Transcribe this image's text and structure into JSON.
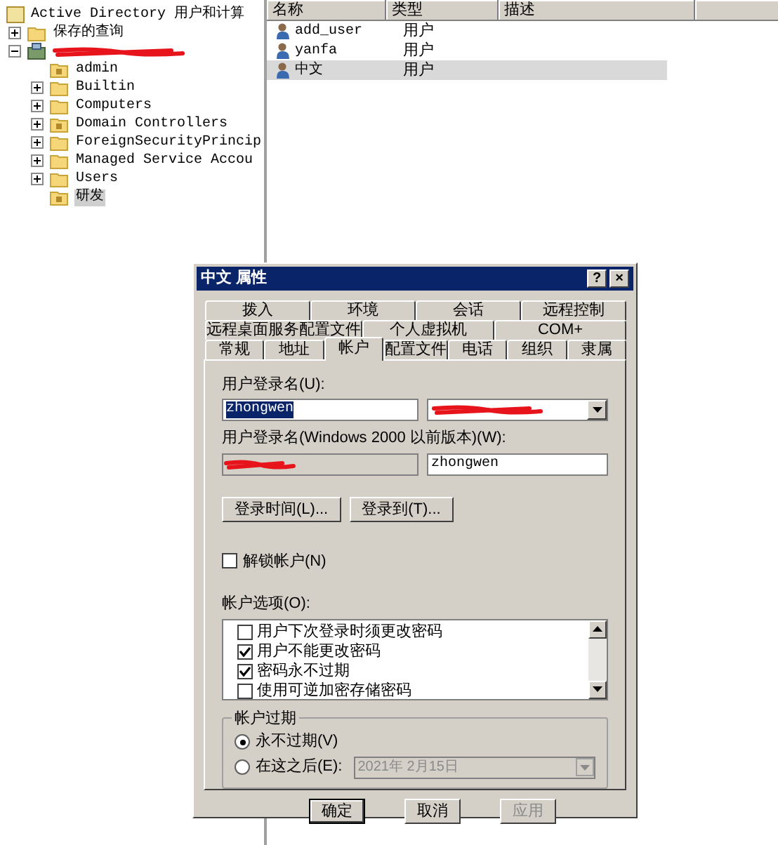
{
  "tree": {
    "header": "Active Directory 用户和计算",
    "items": [
      {
        "kind": "folder",
        "label": "保存的查询",
        "expandable": true,
        "expanded": false,
        "selected": false
      },
      {
        "kind": "domain",
        "redacted": true,
        "expandable": true,
        "expanded": true,
        "selected": false,
        "children": [
          {
            "kind": "ou",
            "label": "admin",
            "expandable": false,
            "selected": false
          },
          {
            "kind": "folder",
            "label": "Builtin",
            "expandable": true,
            "expanded": false,
            "selected": false
          },
          {
            "kind": "folder",
            "label": "Computers",
            "expandable": true,
            "expanded": false,
            "selected": false
          },
          {
            "kind": "ou",
            "label": "Domain Controllers",
            "expandable": true,
            "expanded": false,
            "selected": false
          },
          {
            "kind": "folder",
            "label": "ForeignSecurityPrincip",
            "expandable": true,
            "expanded": false,
            "selected": false
          },
          {
            "kind": "folder",
            "label": "Managed Service Accou",
            "expandable": true,
            "expanded": false,
            "selected": false
          },
          {
            "kind": "folder",
            "label": "Users",
            "expandable": true,
            "expanded": false,
            "selected": false
          },
          {
            "kind": "ou",
            "label": "研发",
            "expandable": false,
            "selected": true
          }
        ]
      }
    ]
  },
  "list": {
    "columns": [
      "名称",
      "类型",
      "描述"
    ],
    "rows": [
      {
        "name": "add_user",
        "type": "用户",
        "selected": false
      },
      {
        "name": "yanfa",
        "type": "用户",
        "selected": false
      },
      {
        "name": "中文",
        "type": "用户",
        "selected": true
      }
    ]
  },
  "dialog": {
    "title": "中文 属性",
    "title_buttons": [
      "?",
      "×"
    ],
    "tab_rows": [
      [
        {
          "label": "拨入",
          "selected": false
        },
        {
          "label": "环境",
          "selected": false
        },
        {
          "label": "会话",
          "selected": false
        },
        {
          "label": "远程控制",
          "selected": false
        }
      ],
      [
        {
          "label": "远程桌面服务配置文件",
          "selected": false
        },
        {
          "label": "个人虚拟机",
          "selected": false
        },
        {
          "label": "COM+",
          "selected": false
        }
      ],
      [
        {
          "label": "常规",
          "selected": false
        },
        {
          "label": "地址",
          "selected": false
        },
        {
          "label": "帐户",
          "selected": true
        },
        {
          "label": "配置文件",
          "selected": false
        },
        {
          "label": "电话",
          "selected": false
        },
        {
          "label": "组织",
          "selected": false
        },
        {
          "label": "隶属",
          "selected": false
        }
      ]
    ],
    "logon_name_label": "用户登录名(U):",
    "logon_name": "zhongwen",
    "suffix_redacted": true,
    "legacy_label": "用户登录名(Windows 2000 以前版本)(W):",
    "domain_redacted": true,
    "legacy_name": "zhongwen",
    "logon_buttons": [
      "登录时间(L)...",
      "登录到(T)..."
    ],
    "unlock": {
      "label": "解锁帐户(N)",
      "checked": false
    },
    "options_label": "帐户选项(O):",
    "options": [
      {
        "label": "用户下次登录时须更改密码",
        "checked": false
      },
      {
        "label": "用户不能更改密码",
        "checked": true
      },
      {
        "label": "密码永不过期",
        "checked": true
      },
      {
        "label": "使用可逆加密存储密码",
        "checked": false
      }
    ],
    "expiry": {
      "title": "帐户过期",
      "choices": [
        {
          "label": "永不过期(V)",
          "selected": true
        },
        {
          "label": "在这之后(E):",
          "selected": false
        }
      ],
      "date": "2021年 2月15日"
    },
    "buttons": [
      {
        "label": "确定",
        "disabled": false,
        "default": true
      },
      {
        "label": "取消",
        "disabled": false,
        "default": false
      },
      {
        "label": "应用",
        "disabled": true,
        "default": false
      }
    ]
  }
}
